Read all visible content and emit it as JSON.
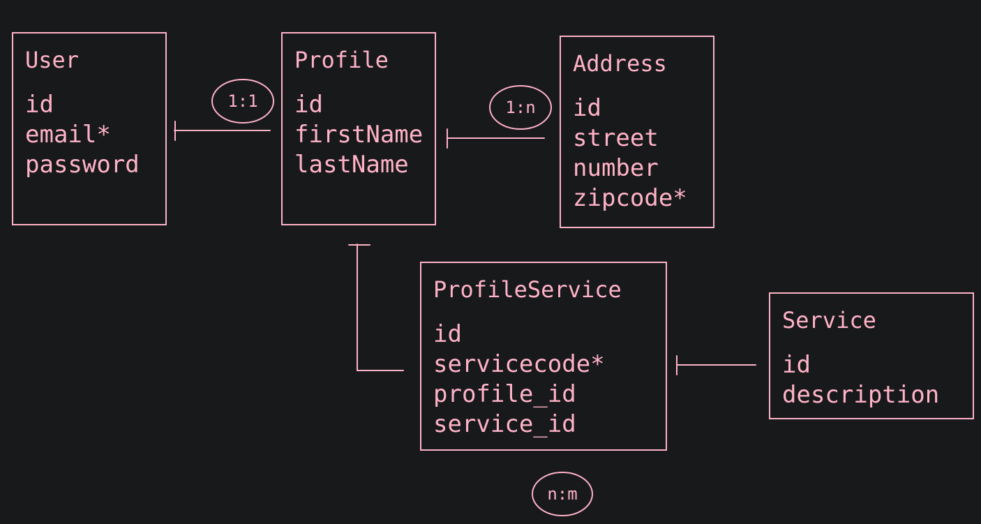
{
  "colors": {
    "background": "#18191b",
    "stroke": "#ffb3c7"
  },
  "entities": {
    "user": {
      "title": "User",
      "fields": [
        "id",
        "email*",
        "password"
      ]
    },
    "profile": {
      "title": "Profile",
      "fields": [
        "id",
        "firstName",
        "lastName"
      ]
    },
    "address": {
      "title": "Address",
      "fields": [
        "id",
        "street",
        "number",
        "zipcode*"
      ]
    },
    "profile_service": {
      "title": "ProfileService",
      "fields": [
        "id",
        "servicecode*",
        "profile_id",
        "service_id"
      ]
    },
    "service": {
      "title": "Service",
      "fields": [
        "id",
        "description"
      ]
    }
  },
  "relations": {
    "user_profile": {
      "cardinality": "1:1"
    },
    "profile_address": {
      "cardinality": "1:n"
    },
    "profile_service": {
      "cardinality": "n:m"
    }
  }
}
